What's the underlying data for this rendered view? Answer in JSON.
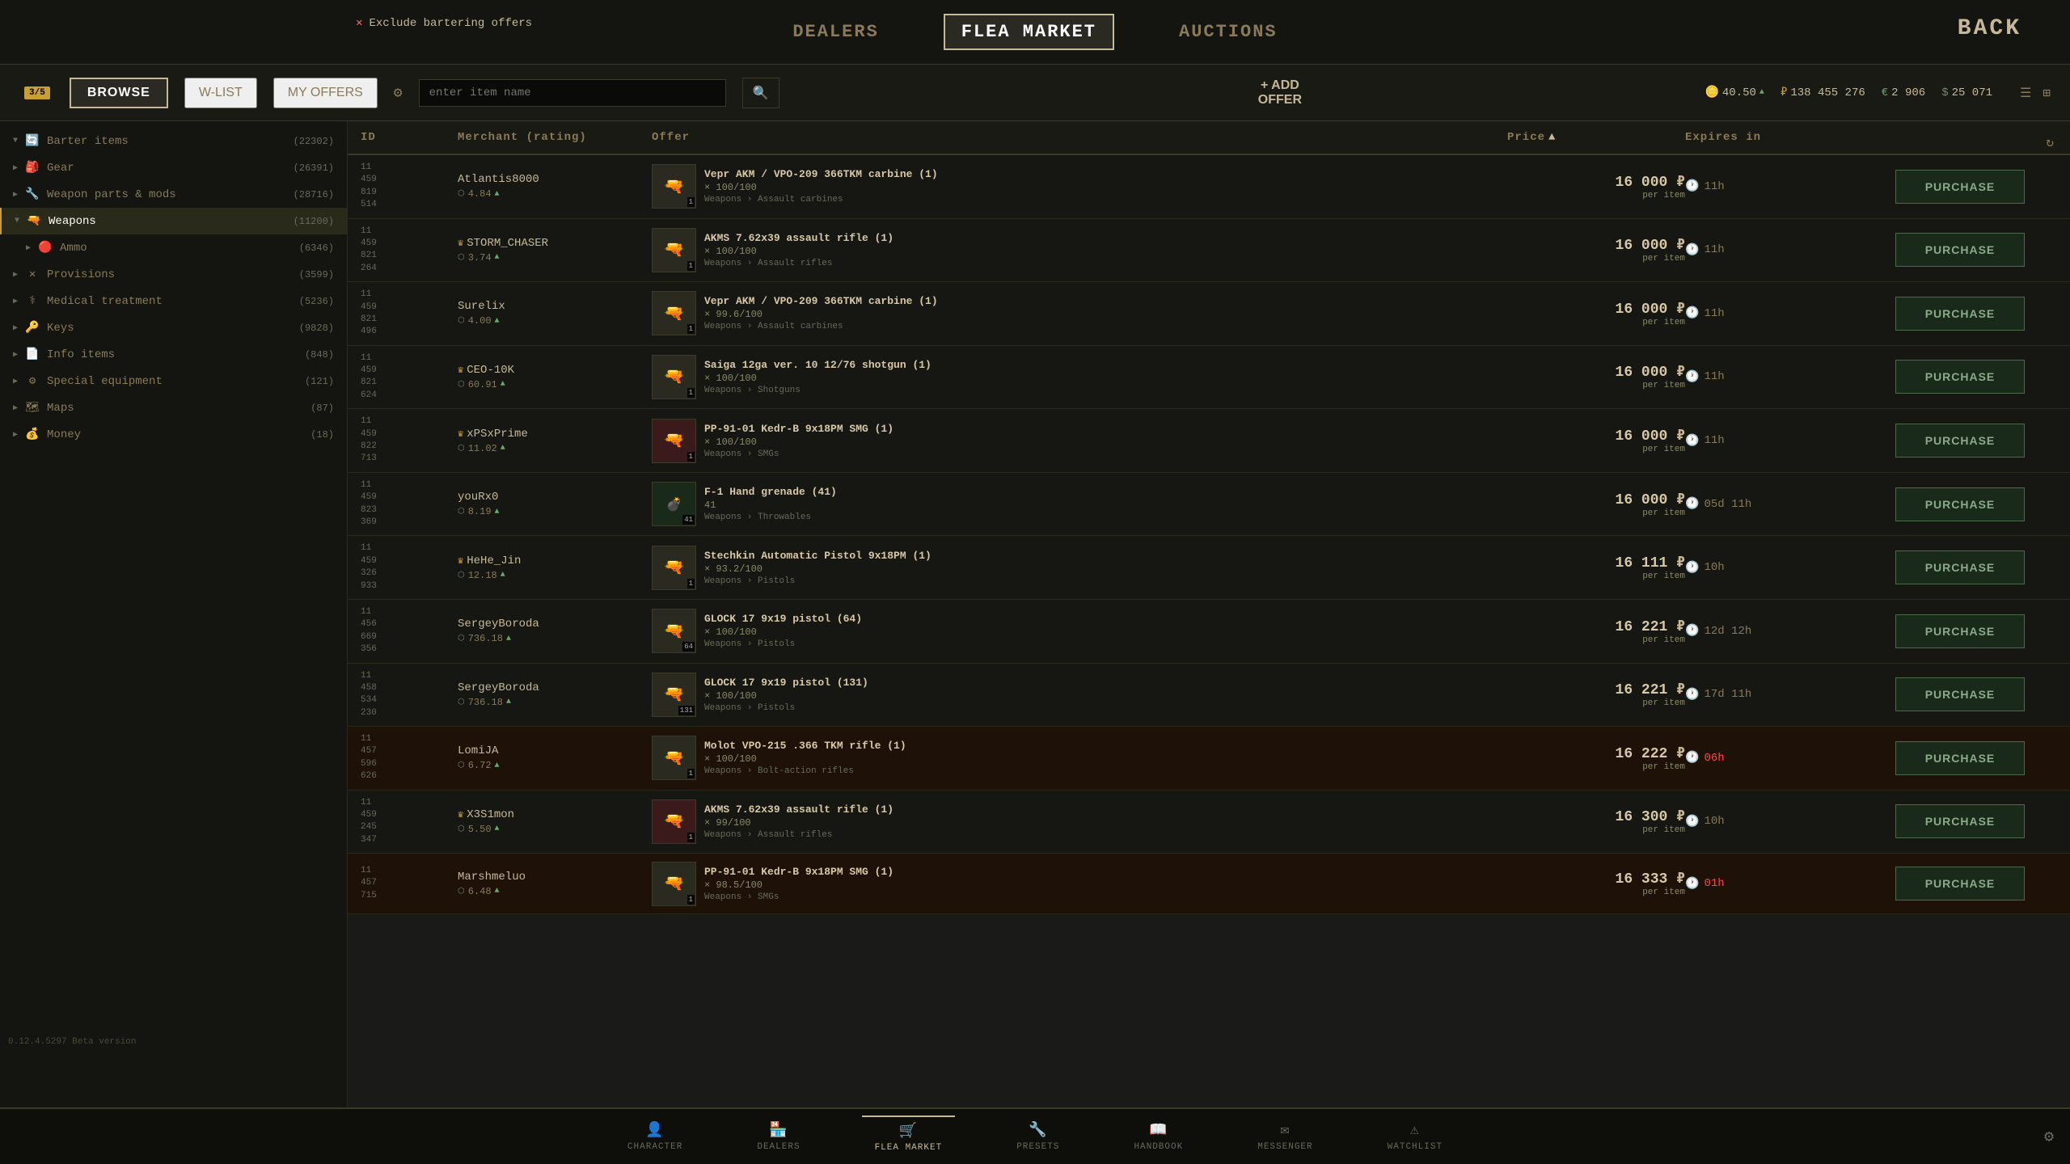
{
  "topNav": {
    "tabs": [
      {
        "label": "DEALERS",
        "id": "dealers",
        "active": false
      },
      {
        "label": "FLEA MARKET",
        "id": "flea-market",
        "active": true
      },
      {
        "label": "AUCTIONS",
        "id": "auctions",
        "active": false
      }
    ],
    "backLabel": "BACK",
    "excludeBarter": "Exclude bartering offers"
  },
  "toolbar": {
    "browseLabel": "BROWSE",
    "wlistLabel": "W-LIST",
    "myOffersLabel": "MY OFFERS",
    "notificationCount": "3/5",
    "searchPlaceholder": "enter item name",
    "addOfferLabel": "+ ADD OFFER",
    "currency": {
      "coin": "40.50",
      "rub": "138 455 276",
      "eur": "2 906",
      "usd": "25 071"
    }
  },
  "tableHeader": {
    "id": "ID",
    "merchant": "Merchant (rating)",
    "offer": "Offer",
    "price": "Price",
    "priceSortLabel": "▲",
    "expiresIn": "Expires in"
  },
  "sidebar": {
    "items": [
      {
        "label": "Barter items",
        "count": "(22302)",
        "icon": "🔄",
        "expanded": true
      },
      {
        "label": "Gear",
        "count": "(26391)",
        "icon": "🎒",
        "expanded": false
      },
      {
        "label": "Weapon parts & mods",
        "count": "(28716)",
        "icon": "🔧",
        "expanded": false
      },
      {
        "label": "Weapons",
        "count": "(11200)",
        "icon": "🔫",
        "expanded": true,
        "active": true
      },
      {
        "label": "Ammo",
        "count": "(6346)",
        "icon": "🔴",
        "expanded": false
      },
      {
        "label": "Provisions",
        "count": "(3599)",
        "icon": "✕",
        "expanded": false
      },
      {
        "label": "Medical treatment",
        "count": "(5236)",
        "icon": "⚕",
        "expanded": false
      },
      {
        "label": "Keys",
        "count": "(9828)",
        "icon": "🔑",
        "expanded": false
      },
      {
        "label": "Info items",
        "count": "(848)",
        "icon": "📄",
        "expanded": false
      },
      {
        "label": "Special equipment",
        "count": "(121)",
        "icon": "⚙",
        "expanded": false
      },
      {
        "label": "Maps",
        "count": "(87)",
        "icon": "🗺",
        "expanded": false
      },
      {
        "label": "Money",
        "count": "(18)",
        "icon": "💰",
        "expanded": false
      }
    ]
  },
  "rows": [
    {
      "ids": [
        "11",
        "459",
        "819",
        "514"
      ],
      "merchant": "Atlantis8000",
      "rating": "4.84",
      "crown": false,
      "itemName": "Vepr AKM / VPO-209 366TKM carbine (1)",
      "itemCount": "× 100/100",
      "category": "Weapons › Assault carbines",
      "price": "16 000",
      "currency": "₽",
      "perItem": "per item",
      "expires": "11h",
      "urgent": false,
      "itemColor": "normal"
    },
    {
      "ids": [
        "11",
        "459",
        "821",
        "264"
      ],
      "merchant": "STORM_CHASER",
      "rating": "3.74",
      "crown": true,
      "itemName": "AKMS 7.62x39 assault rifle (1)",
      "itemCount": "× 100/100",
      "category": "Weapons › Assault rifles",
      "price": "16 000",
      "currency": "₽",
      "perItem": "per item",
      "expires": "11h",
      "urgent": false,
      "itemColor": "normal"
    },
    {
      "ids": [
        "11",
        "459",
        "821",
        "496"
      ],
      "merchant": "Surelix",
      "rating": "4.00",
      "crown": false,
      "itemName": "Vepr AKM / VPO-209 366TKM carbine (1)",
      "itemCount": "× 99.6/100",
      "category": "Weapons › Assault carbines",
      "price": "16 000",
      "currency": "₽",
      "perItem": "per item",
      "expires": "11h",
      "urgent": false,
      "itemColor": "normal"
    },
    {
      "ids": [
        "11",
        "459",
        "821",
        "624"
      ],
      "merchant": "CEO-10K",
      "rating": "60.91",
      "crown": true,
      "itemName": "Saiga 12ga ver. 10 12/76 shotgun (1)",
      "itemCount": "× 100/100",
      "category": "Weapons › Shotguns",
      "price": "16 000",
      "currency": "₽",
      "perItem": "per item",
      "expires": "11h",
      "urgent": false,
      "itemColor": "normal"
    },
    {
      "ids": [
        "11",
        "459",
        "822",
        "713"
      ],
      "merchant": "xPSxPrime",
      "rating": "11.02",
      "crown": true,
      "itemName": "PP-91-01 Kedr-B 9x18PM SMG (1)",
      "itemCount": "× 100/100",
      "category": "Weapons › SMGs",
      "price": "16 000",
      "currency": "₽",
      "perItem": "per item",
      "expires": "11h",
      "urgent": false,
      "itemColor": "red"
    },
    {
      "ids": [
        "11",
        "459",
        "823",
        "369"
      ],
      "merchant": "youRx0",
      "rating": "8.19",
      "crown": false,
      "itemName": "F-1 Hand grenade (41)",
      "itemCount": "41",
      "category": "Weapons › Throwables",
      "price": "16 000",
      "currency": "₽",
      "perItem": "per item",
      "expires": "05d 11h",
      "urgent": false,
      "itemColor": "dark"
    },
    {
      "ids": [
        "11",
        "459",
        "326",
        "933"
      ],
      "merchant": "HeHe_Jin",
      "rating": "12.18",
      "crown": true,
      "itemName": "Stechkin Automatic Pistol 9x18PM (1)",
      "itemCount": "× 93.2/100",
      "category": "Weapons › Pistols",
      "price": "16 111",
      "currency": "₽",
      "perItem": "per item",
      "expires": "10h",
      "urgent": false,
      "itemColor": "normal"
    },
    {
      "ids": [
        "11",
        "456",
        "669",
        "356"
      ],
      "merchant": "SergeyBoroda",
      "rating": "736.18",
      "crown": false,
      "itemName": "GLOCK 17 9x19 pistol (64)",
      "itemCount": "× 100/100",
      "category": "Weapons › Pistols",
      "price": "16 221",
      "currency": "₽",
      "perItem": "per item",
      "expires": "12d 12h",
      "urgent": false,
      "itemColor": "normal",
      "qty": "64"
    },
    {
      "ids": [
        "11",
        "458",
        "534",
        "230"
      ],
      "merchant": "SergeyBoroda",
      "rating": "736.18",
      "crown": false,
      "itemName": "GLOCK 17 9x19 pistol (131)",
      "itemCount": "× 100/100",
      "category": "Weapons › Pistols",
      "price": "16 221",
      "currency": "₽",
      "perItem": "per item",
      "expires": "17d 11h",
      "urgent": false,
      "itemColor": "normal",
      "qty": "131"
    },
    {
      "ids": [
        "11",
        "457",
        "596",
        "626"
      ],
      "merchant": "LomiJA",
      "rating": "6.72",
      "crown": false,
      "itemName": "Molot VPO-215 .366 TKM rifle (1)",
      "itemCount": "× 100/100",
      "category": "Weapons › Bolt-action rifles",
      "price": "16 222",
      "currency": "₽",
      "perItem": "per item",
      "expires": "06h",
      "urgent": true,
      "itemColor": "normal"
    },
    {
      "ids": [
        "11",
        "459",
        "245",
        "347"
      ],
      "merchant": "X3S1mon",
      "rating": "5.50",
      "crown": true,
      "itemName": "AKMS 7.62x39 assault rifle (1)",
      "itemCount": "× 99/100",
      "category": "Weapons › Assault rifles",
      "price": "16 300",
      "currency": "₽",
      "perItem": "per item",
      "expires": "10h",
      "urgent": false,
      "itemColor": "red"
    },
    {
      "ids": [
        "11",
        "457",
        "715",
        ""
      ],
      "merchant": "Marshmeluo",
      "rating": "6.48",
      "crown": false,
      "itemName": "PP-91-01 Kedr-B 9x18PM SMG (1)",
      "itemCount": "× 98.5/100",
      "category": "Weapons › SMGs",
      "price": "16 333",
      "currency": "₽",
      "perItem": "per item",
      "expires": "01h",
      "urgent": true,
      "itemColor": "normal"
    }
  ],
  "bottomNav": {
    "items": [
      {
        "label": "CHARACTER",
        "icon": "👤",
        "active": false
      },
      {
        "label": "DEALERS",
        "icon": "🏪",
        "active": false
      },
      {
        "label": "FLEA MARKET",
        "icon": "🛒",
        "active": true
      },
      {
        "label": "PRESETS",
        "icon": "🔧",
        "active": false
      },
      {
        "label": "HANDBOOK",
        "icon": "📖",
        "active": false
      },
      {
        "label": "MESSENGER",
        "icon": "✉",
        "active": false
      },
      {
        "label": "WATCHLIST",
        "icon": "⚠",
        "active": false
      }
    ]
  },
  "version": "0.12.4.5297 Beta version"
}
